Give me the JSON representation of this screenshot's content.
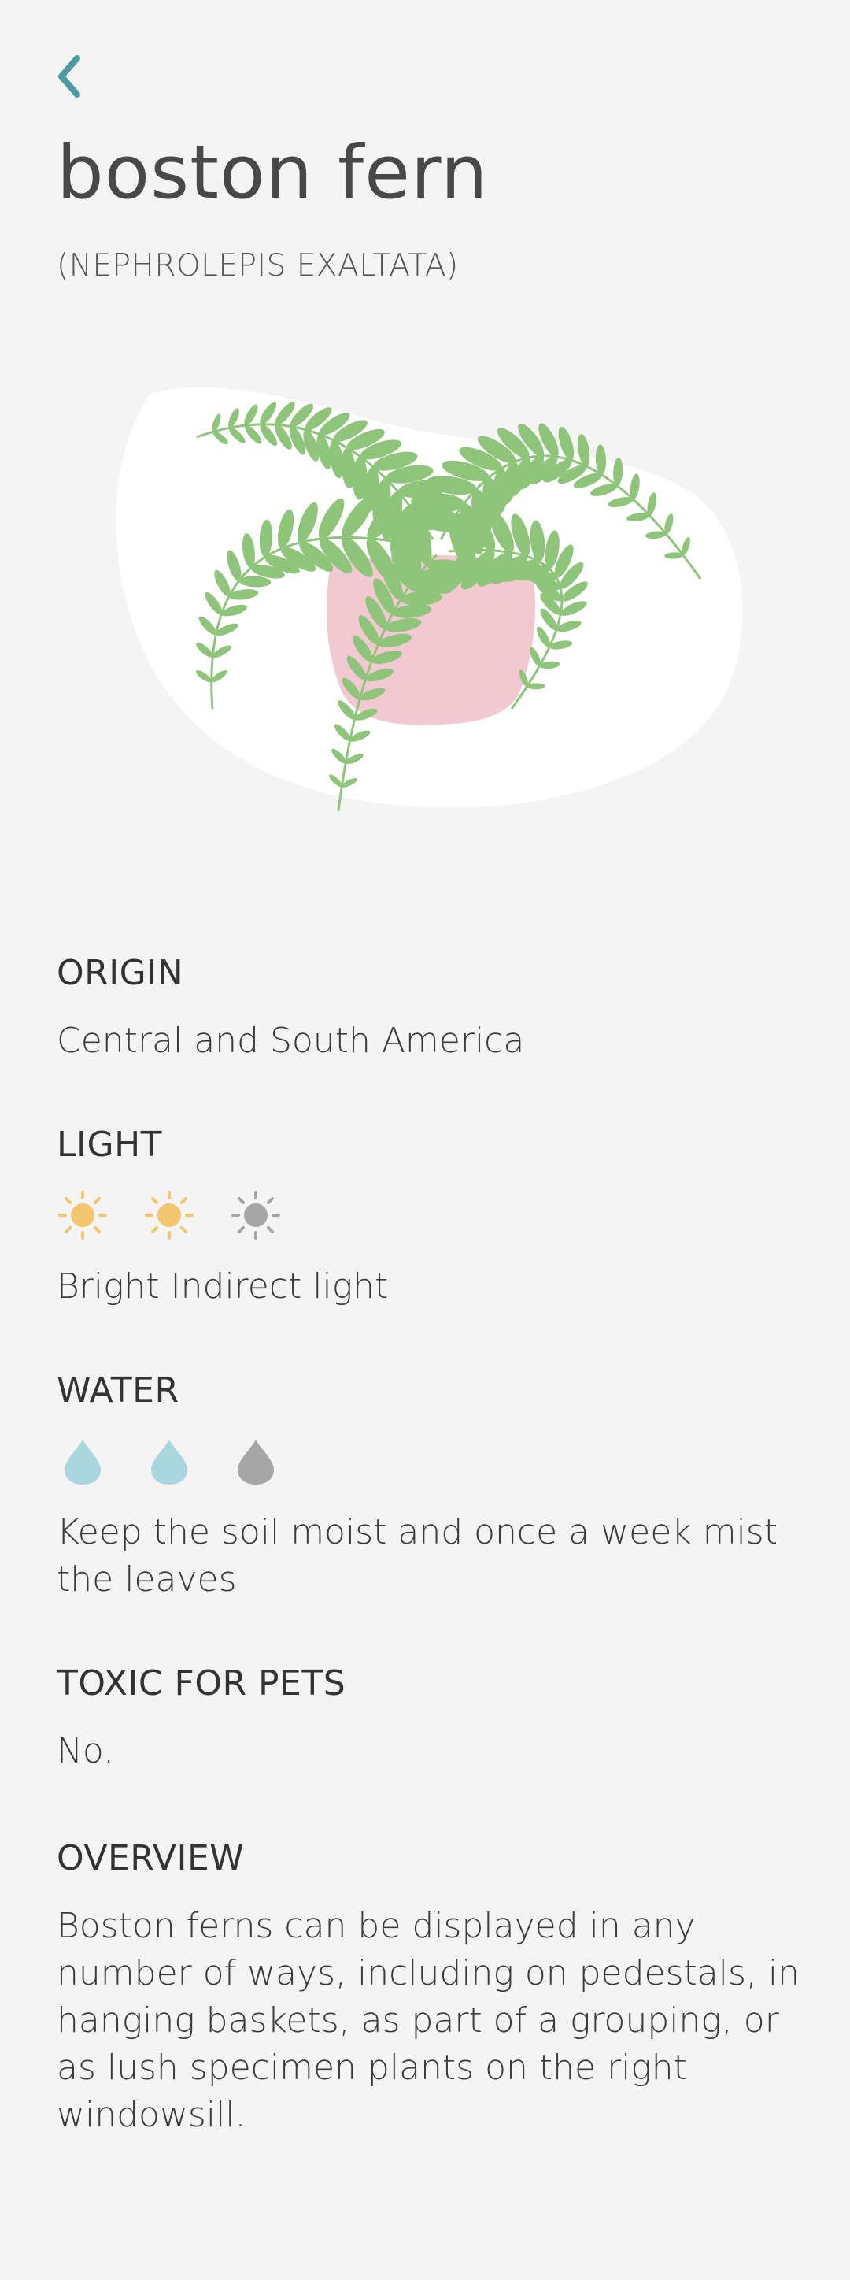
{
  "header": {
    "back_icon": "chevron-left-icon",
    "title": "boston fern",
    "scientific_name": "(NEPHROLEPIS EXALTATA)"
  },
  "illustration": {
    "icon": "potted-fern-illustration",
    "colors": {
      "leaf": "#8fc47b",
      "pot": "#f2c9d0",
      "backdrop": "#ffffff"
    }
  },
  "sections": {
    "origin": {
      "heading": "ORIGIN",
      "text": "Central and South America"
    },
    "light": {
      "heading": "LIGHT",
      "icon": "sun-icon",
      "level": 2,
      "max": 3,
      "active_color": "#f4c66f",
      "inactive_color": "#a6a6a6",
      "text": "Bright Indirect light"
    },
    "water": {
      "heading": "WATER",
      "icon": "water-drop-icon",
      "level": 2,
      "max": 3,
      "active_color": "#a9d5df",
      "inactive_color": "#a6a6a6",
      "text": "Keep the soil moist and once a week mist the leaves"
    },
    "toxic": {
      "heading": "TOXIC FOR PETS",
      "text": "No."
    },
    "overview": {
      "heading": "OVERVIEW",
      "text": "Boston ferns can be displayed in any number of ways, including on pedestals, in hanging baskets, as part of a grouping, or as lush specimen plants on the right windowsill."
    }
  },
  "colors": {
    "background": "#f4f4f4",
    "accent": "#4d9aa0"
  }
}
